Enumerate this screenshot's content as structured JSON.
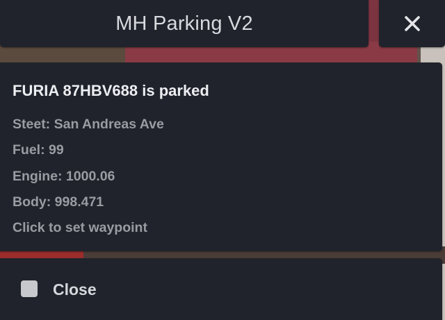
{
  "window": {
    "title": "MH Parking V2",
    "close_icon": "close-icon"
  },
  "vehicle": {
    "heading": "FURIA 87HBV688 is parked",
    "street": "Steet: San Andreas Ave",
    "fuel": "Fuel: 99",
    "engine": "Engine: 1000.06",
    "body": "Body: 998.471",
    "waypoint": "Click to set waypoint"
  },
  "footer": {
    "checkbox_icon": "checkbox-icon",
    "close_label": "Close"
  },
  "colors": {
    "panel_bg": "#20232b",
    "title_text": "#d8dadf",
    "secondary_text": "#9a9ca3"
  }
}
